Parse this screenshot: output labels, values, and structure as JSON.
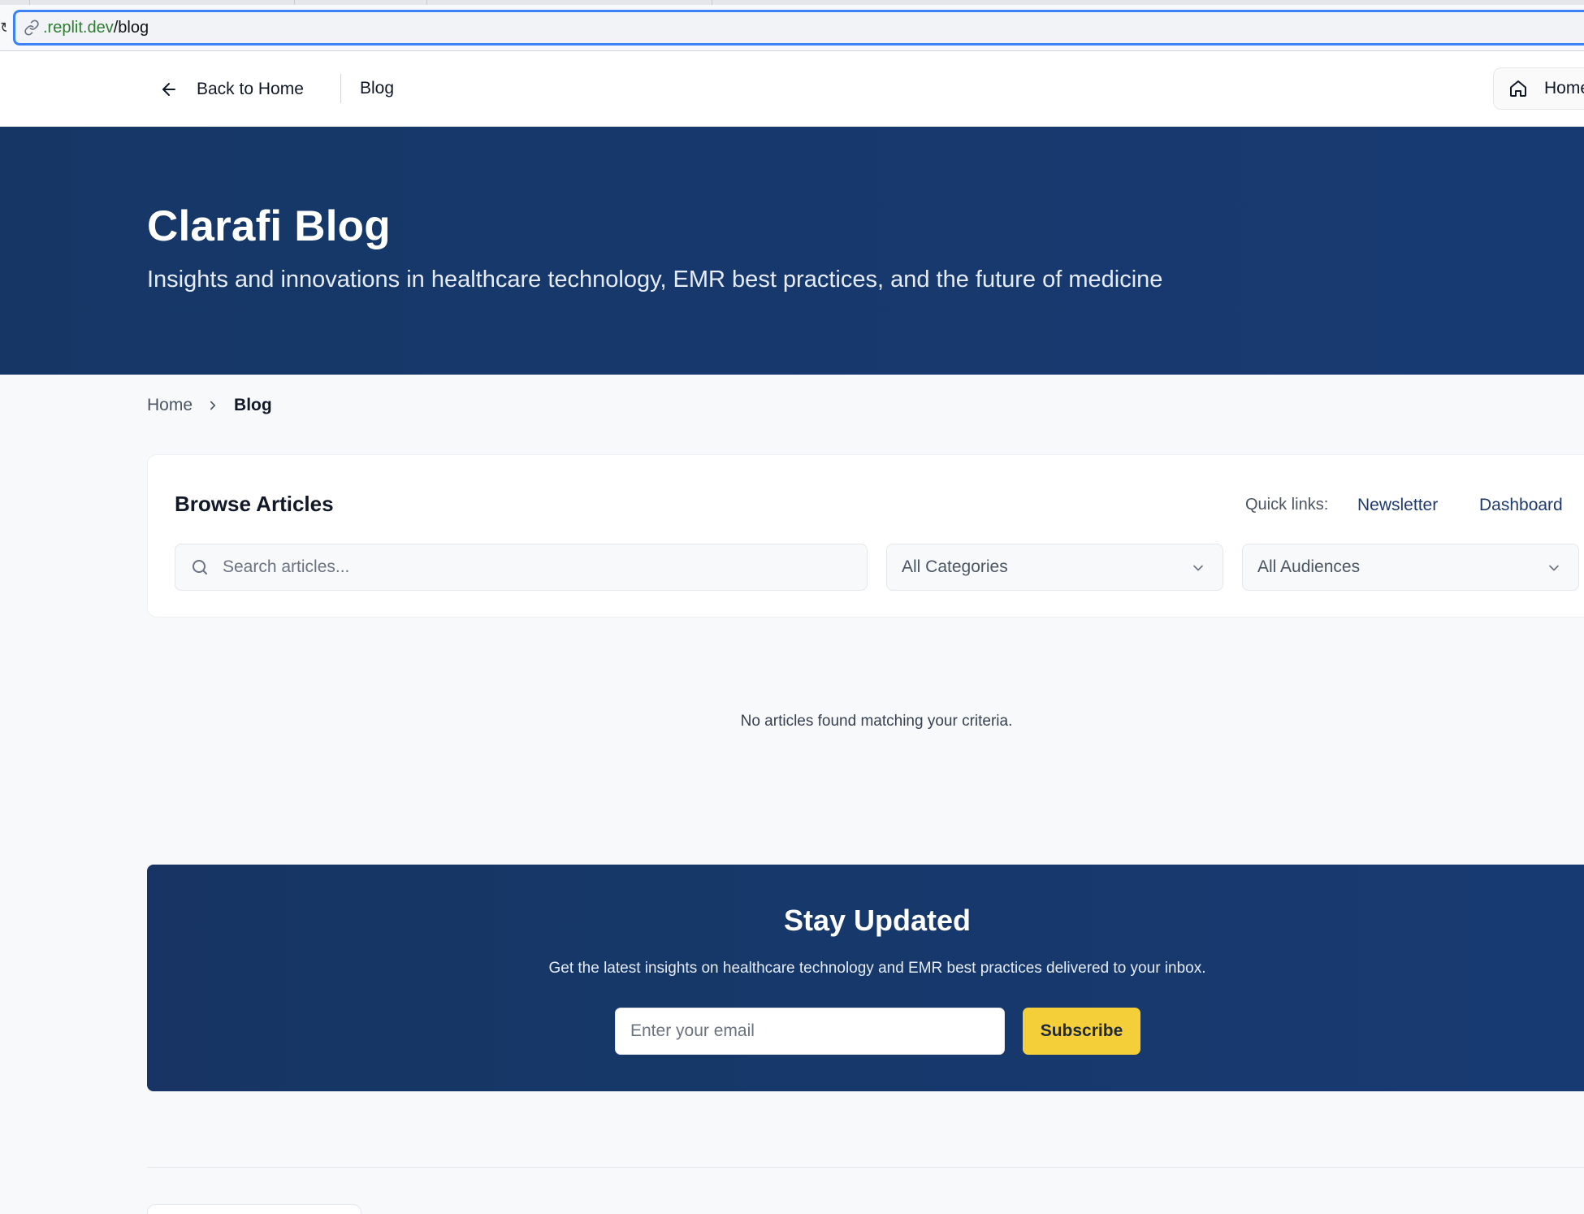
{
  "browser": {
    "url_host": ".replit.dev",
    "url_path": "/blog"
  },
  "nav": {
    "back_label": "Back to Home",
    "current_label": "Blog",
    "home_button_label": "Home"
  },
  "hero": {
    "title": "Clarafi Blog",
    "subtitle": "Insights and innovations in healthcare technology, EMR best practices, and the future of medicine"
  },
  "breadcrumb": {
    "home": "Home",
    "current": "Blog"
  },
  "browse": {
    "title": "Browse Articles",
    "quick_links_label": "Quick links:",
    "quick_links": [
      "Newsletter",
      "Dashboard"
    ],
    "search_placeholder": "Search articles...",
    "category_selected": "All Categories",
    "audience_selected": "All Audiences"
  },
  "results": {
    "empty_message": "No articles found matching your criteria."
  },
  "newsletter": {
    "title": "Stay Updated",
    "description": "Get the latest insights on healthcare technology and EMR best practices delivered to your inbox.",
    "email_placeholder": "Enter your email",
    "subscribe_label": "Subscribe"
  },
  "icons": {
    "url": "link-icon",
    "back": "arrow-left-icon",
    "home": "home-icon",
    "breadcrumb_separator": "chevron-right-icon",
    "search": "search-icon",
    "dropdown": "chevron-down-icon"
  },
  "colors": {
    "hero_bg": "#163766",
    "accent_link": "#1e3a6e",
    "subscribe_bg": "#f5cf3a",
    "page_bg": "#f8f9fb"
  }
}
